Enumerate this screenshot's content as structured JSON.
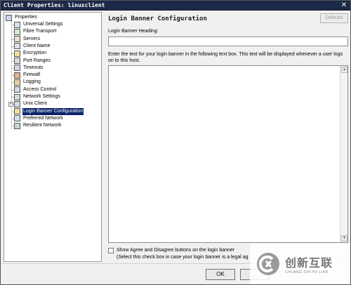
{
  "window": {
    "title": "Client Properties: linuxclient",
    "close_glyph": "✕"
  },
  "tree": {
    "root_label": "Properties",
    "expander_glyph": "+",
    "items": [
      {
        "label": "Universal Settings",
        "icon": "universal-settings-icon"
      },
      {
        "label": "Fibre Transport",
        "icon": "fibre-transport-icon"
      },
      {
        "label": "Servers",
        "icon": "servers-icon"
      },
      {
        "label": "Client Name",
        "icon": "client-name-icon"
      },
      {
        "label": "Encryption",
        "icon": "lock-icon"
      },
      {
        "label": "Port Ranges",
        "icon": "port-ranges-icon"
      },
      {
        "label": "Timeouts",
        "icon": "clock-icon"
      },
      {
        "label": "Firewall",
        "icon": "firewall-icon"
      },
      {
        "label": "Logging",
        "icon": "logging-icon"
      },
      {
        "label": "Access Control",
        "icon": "access-control-icon"
      },
      {
        "label": "Network Settings",
        "icon": "network-settings-icon"
      },
      {
        "label": "Unix Client",
        "icon": "unix-client-icon"
      },
      {
        "label": "Login Banner Configuration",
        "icon": "login-banner-icon",
        "selected": true
      },
      {
        "label": "Preferred Network",
        "icon": "preferred-network-icon"
      },
      {
        "label": "Resilient Network",
        "icon": "resilient-network-icon"
      }
    ]
  },
  "panel": {
    "heading": "Login Banner Configuration",
    "defaults_label": "Defaults",
    "heading_field_label": "Login Banner Heading:",
    "heading_field_value": "",
    "instructions": "Enter the text for your login banner in the following text box. This text will be displayed whenever a user logs on to this host.",
    "banner_text_value": "",
    "checkbox_checked": false,
    "checkbox_label": "Show Agree and Disagree buttons on the login banner",
    "checkbox_hint": "(Select this check box in case your login banner is a legal ag"
  },
  "buttons": {
    "ok_label": "OK"
  },
  "watermark": {
    "cn_text": "创新互联",
    "en_text": "CHUANG XIN HU LIAN"
  }
}
